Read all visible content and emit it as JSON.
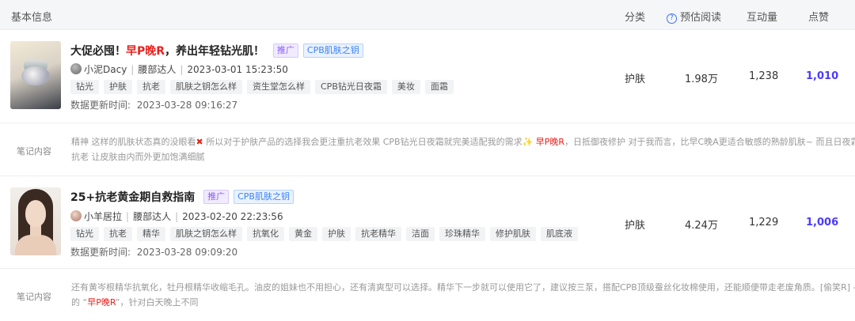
{
  "header": {
    "basic_info": "基本信息",
    "category": "分类",
    "reads": "预估阅读",
    "interaction": "互动量",
    "likes": "点赞",
    "help_icon_glyph": "?"
  },
  "notes": [
    {
      "title_main": "大促必囤！",
      "title_red": "早P晚R",
      "title_rest": "，养出年轻钻光肌！",
      "badges": [
        "推广",
        "CPB肌肤之钥"
      ],
      "author": "小泥Dacy",
      "level": "腰部达人",
      "time": "2023-03-01 15:23:50",
      "tags": [
        "钻光",
        "护肤",
        "抗老",
        "肌肤之钥怎么样",
        "资生堂怎么样",
        "CPB钻光日夜霜",
        "美妆",
        "面霜"
      ],
      "updated_label": "数据更新时间:",
      "updated_time": "2023-03-28 09:16:27",
      "category": "护肤",
      "reads": "1.98万",
      "interaction": "1,238",
      "likes": "1,010",
      "content_label": "笔记内容",
      "content_1a": "精神 这样的肌肤状态真的没眼看",
      "content_1b": " 所以对于护肤产品的选择我会更注重抗老效果 CPB钻光日夜霜就完美适配我的需求",
      "content_red": "早P晚R",
      "content_1c": "，日抵御夜修护 对于我而言，比早C晚A更适合敏感的熟龄肌肤~ 而且日夜霜",
      "content_2": "抗老 让皮肤由内而外更加饱满细腻"
    },
    {
      "title_main": "25+抗老黄金期自救指南",
      "badges": [
        "推广",
        "CPB肌肤之钥"
      ],
      "author": "小羊居拉",
      "level": "腰部达人",
      "time": "2023-02-20 22:23:56",
      "tags": [
        "钻光",
        "抗老",
        "精华",
        "肌肤之钥怎么样",
        "抗氧化",
        "黄金",
        "护肤",
        "抗老精华",
        "洁面",
        "珍珠精华",
        "修护肌肤",
        "肌底液"
      ],
      "updated_label": "数据更新时间:",
      "updated_time": "2023-03-28 09:09:20",
      "category": "护肤",
      "reads": "4.24万",
      "interaction": "1,229",
      "likes": "1,006",
      "content_label": "笔记内容",
      "content_1": "还有黄岑根精华抗氧化，牡丹根精华收缩毛孔。油皮的姐妹也不用担心，还有清爽型可以选择。精华下一步就可以使用它了，建议按三泵，搭配CPB顶级蚕丝化妆棉使用，还能顺便带走老废角质。[偷笑R] - C",
      "content_2a": "的 “",
      "content_red": "早P晚R",
      "content_2b": "”，针对白天晚上不同"
    }
  ],
  "icons": {
    "x_mark": "✖",
    "sparkle": "✨"
  },
  "colors": {
    "accent": "#3b73f6",
    "likes": "#4a3aff",
    "highlight_red": "#e8211c"
  }
}
